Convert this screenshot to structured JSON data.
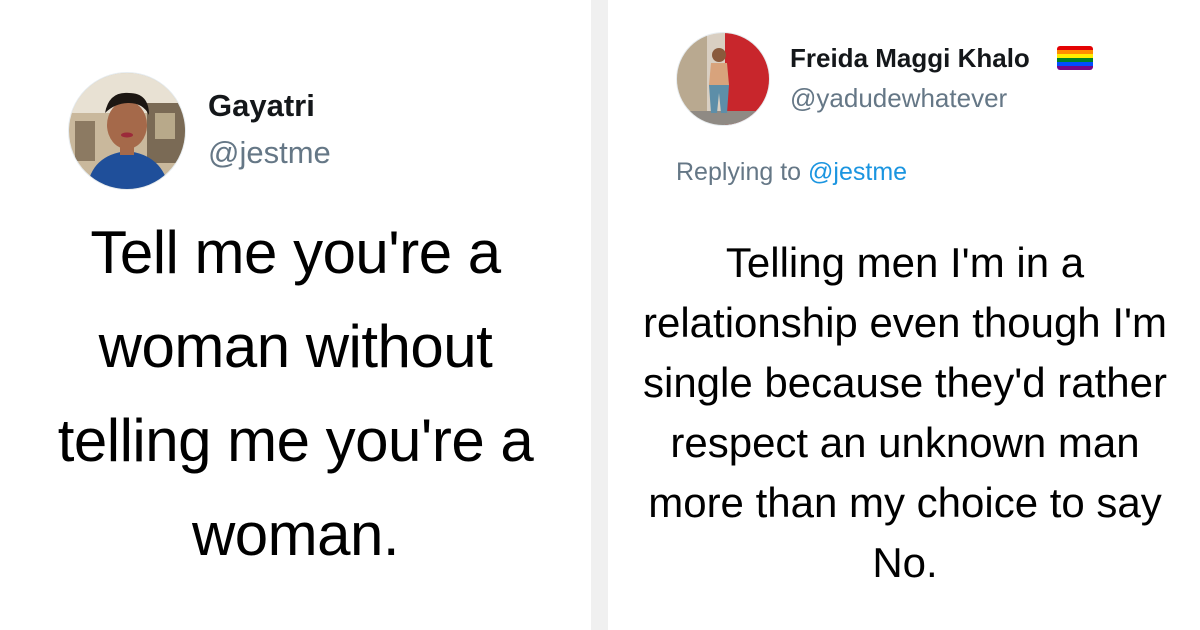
{
  "left_tweet": {
    "author_name": "Gayatri",
    "author_handle": "@jestme",
    "body": "Tell me you're a woman without telling me you're a woman."
  },
  "right_tweet": {
    "author_name": "Freida Maggi Khalo",
    "author_handle": "@yadudewhatever",
    "name_emoji": "rainbow-flag-icon",
    "replying_prefix": "Replying to",
    "replying_handle": "@jestme",
    "body": "Telling men I'm in a relationship even though I'm single because they'd rather respect an unknown man more than my choice to say No."
  },
  "colors": {
    "handle": "#657786",
    "mention": "#1b95e0",
    "name": "#14171a",
    "divider_background": "#f0f0f0"
  }
}
